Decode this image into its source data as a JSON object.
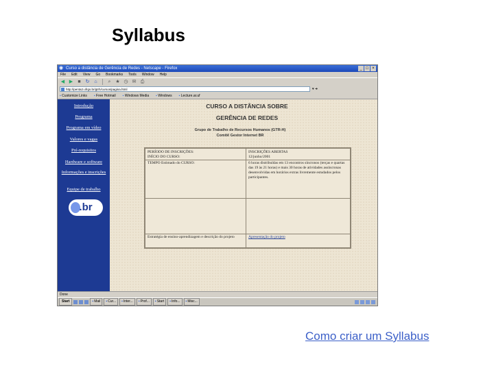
{
  "slide": {
    "title": "Syllabus",
    "footer_link": "Como criar um  Syllabus"
  },
  "browser": {
    "window_title": "Curso a distância de Gerência de Redes - Netscape - Firefox",
    "menu": [
      "File",
      "Edit",
      "View",
      "Go",
      "Bookmarks",
      "Tools",
      "Window",
      "Help"
    ],
    "address": "http://penta2.ufrgs.br/gtrh/cursos/pagina.html",
    "links": [
      "Customize Links",
      "Free Hotmail",
      "Windows Media",
      "Windows",
      "Lecture.ar.uf"
    ],
    "status": "Done"
  },
  "sidebar": {
    "items": [
      "Introdução",
      "Programa",
      "Programa em vídeo",
      "Valores e vagas",
      "Pré-requisitos",
      "Hardware e software",
      "Informações e inscrições",
      "Equipe de trabalho"
    ],
    "logo_text": ".br"
  },
  "page": {
    "heading1": "CURSO A DISTÂNCIA SOBRE",
    "heading2": "GERÊNCIA DE REDES",
    "sub1": "Grupo de Trabalho de Recursos Humanos (GTR-H)",
    "sub2": "Comitê Gestor Internet BR"
  },
  "table": {
    "r1c1": "PERÍODO DE INSCRIÇÕES:",
    "r1c2": "INSCRIÇÕES ABERTAS",
    "r2c1": "INÍCIO DO CURSO:",
    "r2c2": "12/junho/2001",
    "r3c1": "TEMPO Estimado do CURSO:",
    "r3c2": "6 horas distribuídas em 13 encontros síncronos (terças e quartas das 19 às 21 horas) e mais 30 horas de atividades assíncronas desenvolvidas em horários extras livremente estudados pelos participantes.",
    "r4c1": "Estratégia de ensino-aprendizagem e descrição do projeto",
    "r4c2": "Apresentação do projeto"
  },
  "taskbar": {
    "start": "Start",
    "buttons": [
      "Mail",
      "Cur...",
      "Inter...",
      "Prof...",
      "Start",
      "Info...",
      "Misc..."
    ]
  }
}
